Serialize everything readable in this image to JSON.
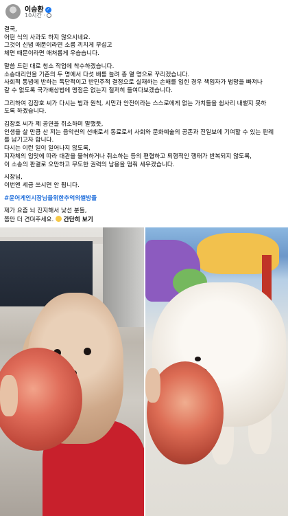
{
  "post": {
    "author": "이승환",
    "verified_icon": "verified-check-icon",
    "time": "10시간",
    "visibility_icon": "globe-icon"
  },
  "paragraphs": [
    [
      "결국,",
      "어떤 식의 사과도 하지 않으시네요.",
      "그것이 신념 때문이라면 소름 끼치게 무섭고",
      "체면 때문이라면 애처롭게 우습습니다."
    ],
    [
      "말씀 드린 대로 청소 작업에 착수하겠습니다.",
      "소송대리인을 기존의 두 명에서 다섯 배를 늘려 총 열 명으로 꾸리겠습니다.",
      "사회적 통념에 반하는 독단적이고 반민주적 결정으로 실재하는 손해를 입힌 경우 책임자가 법망을 빠져나",
      "갈 수 없도록 국가배상법에 맹점은 없는지 철저히 들여다보겠습니다."
    ],
    [
      "그리하여 김장호 씨가 다시는 법과 원칙, 시민과 안전이라는 스스로에게 없는 가치들을 쉽사리 내뱉지 못하",
      "도록 하겠습니다."
    ],
    [
      "김장호 씨가 제 공연을 취소하며 말했듯,",
      "인생을 살 만큼 산 저는 음악씬의 선배로서 동료로서 사회와 문화예술의 공존과 진일보에 기여할 수 있는 판례",
      "를 남기고자 합니다.",
      "다시는 이런 일이 일어나지 않도록,",
      "지자체의 입맛에 따라 대관을 불허하거나 취소하는 등의 편협하고 퇴행적인 행태가 반복되지 않도록,",
      "이 소송의 판결로 오만하고 무도한 권력의 남용을 멈춰 세우겠습니다."
    ],
    [
      "시장님,",
      "이번엔 세금 쓰시면 안 됩니다."
    ]
  ],
  "hashtag": "#윤어게인시장님을위한추억의썰방출",
  "closing": [
    "제가 요즘 뇌 진지해서 낯선 분들,",
    "쫌만 더 견뎌주세요."
  ],
  "emoji_icon": "smiling-face-emoji",
  "see_more": "간단히 보기",
  "photos": [
    {
      "name": "photo-left",
      "subject": "poodle-with-apple"
    },
    {
      "name": "photo-right",
      "subject": "maltese-with-apple"
    }
  ]
}
